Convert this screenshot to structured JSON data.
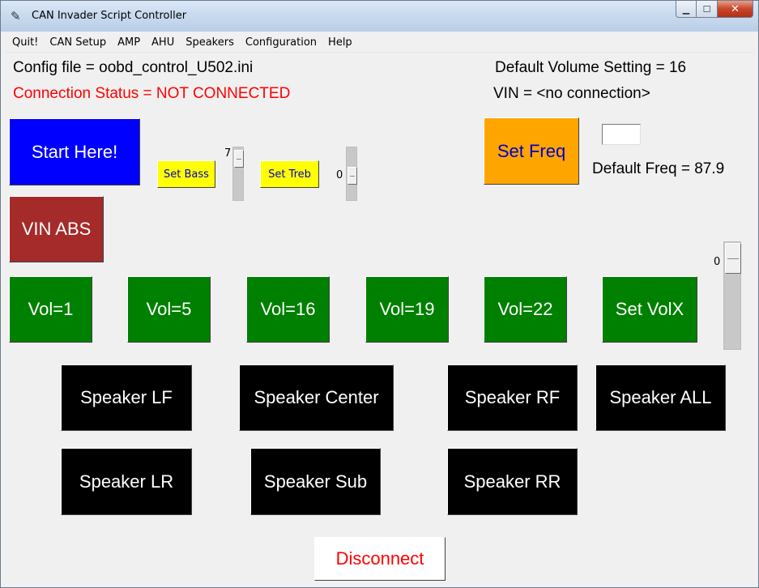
{
  "window": {
    "title": "CAN Invader Script Controller",
    "min_glyph": "▁",
    "max_glyph": "☐",
    "close_glyph": "✕"
  },
  "menu": [
    "Quit!",
    "CAN Setup",
    "AMP",
    "AHU",
    "Speakers",
    "Configuration",
    "Help"
  ],
  "status": {
    "config_file": "Config file = oobd_control_U502.ini",
    "connection": "Connection Status = NOT CONNECTED",
    "default_volume": "Default Volume Setting = 16",
    "vin": "VIN = <no connection>",
    "default_freq": "Default Freq = 87.9"
  },
  "buttons": {
    "start": "Start Here!",
    "set_bass": "Set Bass",
    "set_treb": "Set Treb",
    "set_freq": "Set Freq",
    "vin_abs": "VIN ABS",
    "disconnect": "Disconnect"
  },
  "sliders": {
    "bass": 7,
    "treb": 0,
    "volume": 0
  },
  "volume_buttons": [
    "Vol=1",
    "Vol=5",
    "Vol=16",
    "Vol=19",
    "Vol=22",
    "Set VolX"
  ],
  "speaker_buttons": [
    "Speaker LF",
    "Speaker Center",
    "Speaker RF",
    "Speaker ALL",
    "Speaker LR",
    "Speaker Sub",
    "Speaker RR"
  ],
  "freq_entry_value": "",
  "colors": {
    "start": "#0000ff",
    "vin_abs": "#a52a2a",
    "volume": "#008000",
    "speaker": "#000000",
    "set_freq": "#ffa500",
    "tone": "#ffff00",
    "connection_status": "#ff0000"
  }
}
